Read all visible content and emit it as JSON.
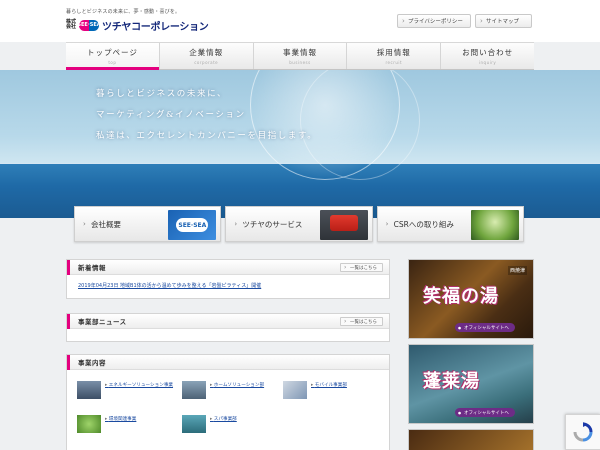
{
  "header": {
    "tagline": "暮らしとビジネスの未来に、夢・感動・喜びを。",
    "logo": {
      "kaisha": "株式会社",
      "mark": "SEE·SEA",
      "name": "ツチヤコーポレーション"
    },
    "utility": {
      "privacy": "プライバシーポリシー",
      "sitemap": "サイトマップ"
    }
  },
  "nav": [
    {
      "label": "トップページ",
      "sub": "top",
      "active": true
    },
    {
      "label": "企業情報",
      "sub": "corporate"
    },
    {
      "label": "事業情報",
      "sub": "business"
    },
    {
      "label": "採用情報",
      "sub": "recruit"
    },
    {
      "label": "お問い合わせ",
      "sub": "inquiry"
    }
  ],
  "hero": {
    "line1": "暮らしとビジネスの未来に、",
    "line2": "マーケティング&イノベーション",
    "line3": "私達は、エクセレントカンパニーを目指します。"
  },
  "features": [
    {
      "label": "会社概要",
      "image_text": "SEE·SEA"
    },
    {
      "label": "ツチヤのサービス"
    },
    {
      "label": "CSRへの取り組み"
    }
  ],
  "news": {
    "title": "新着情報",
    "more": "一覧はこちら",
    "items": [
      "2019年04月23日 地域B1体の活から温めて歩みを整える「岩盤ピラティス」開催"
    ]
  },
  "bizdept_news": {
    "title": "事業部ニュース",
    "more": "一覧はこちら"
  },
  "business": {
    "title": "事業内容",
    "items": [
      {
        "label": "エネルギーソリューション事業"
      },
      {
        "label": "ホームソリューション部"
      },
      {
        "label": "モバイル事業部"
      },
      {
        "label": "環境関連事業"
      },
      {
        "label": "スパ事業部"
      }
    ]
  },
  "banners": [
    {
      "tag": "西焼津",
      "title": "笑福の湯",
      "button": "オフィシャルサイトへ"
    },
    {
      "title": "蓬莱湯",
      "button": "オフィシャルサイトへ"
    },
    {
      "title": ""
    }
  ],
  "colors": {
    "accent": "#e4007f",
    "brand_blue": "#14287a",
    "link": "#1a4aa0"
  }
}
